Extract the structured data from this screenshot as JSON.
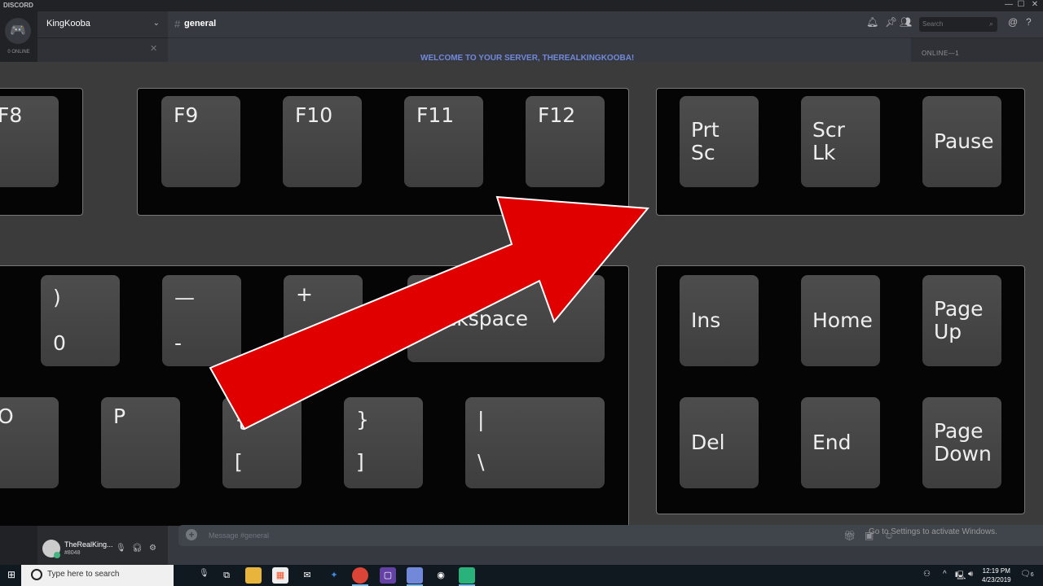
{
  "app": {
    "brand": "DISCORD",
    "window_controls": [
      "—",
      "☐",
      "✕"
    ]
  },
  "guilds": {
    "online_count": "0 ONLINE"
  },
  "server": {
    "name": "KingKooba"
  },
  "channel": {
    "name": "general",
    "hash": "#"
  },
  "header": {
    "search_placeholder": "Search"
  },
  "chat": {
    "welcome": "WELCOME TO YOUR SERVER, THEREALKINGKOOBA!",
    "message_placeholder": "Message #general"
  },
  "members": {
    "header": "ONLINE—1"
  },
  "user": {
    "name": "TheRealKing...",
    "tag": "#8048"
  },
  "keyboard": {
    "top_keys": [
      "F8",
      "F9",
      "F10",
      "F11",
      "F12",
      "Prt\nSc",
      "Scr\nLk",
      "Pause"
    ],
    "left_keys": [
      ")\n0",
      "—\n-",
      "+",
      "Backspace",
      "O",
      "P",
      "{\n[",
      "}\n]",
      "|\n\\"
    ],
    "nav_keys": [
      "Ins",
      "Home",
      "Page\nUp",
      "Del",
      "End",
      "Page\nDown"
    ],
    "arrow_color": "#e00000"
  },
  "watermark": "Go to Settings to activate Windows.",
  "taskbar": {
    "search_placeholder": "Type here to search",
    "time": "12:19 PM",
    "date": "4/23/2019",
    "notifications": "6"
  }
}
